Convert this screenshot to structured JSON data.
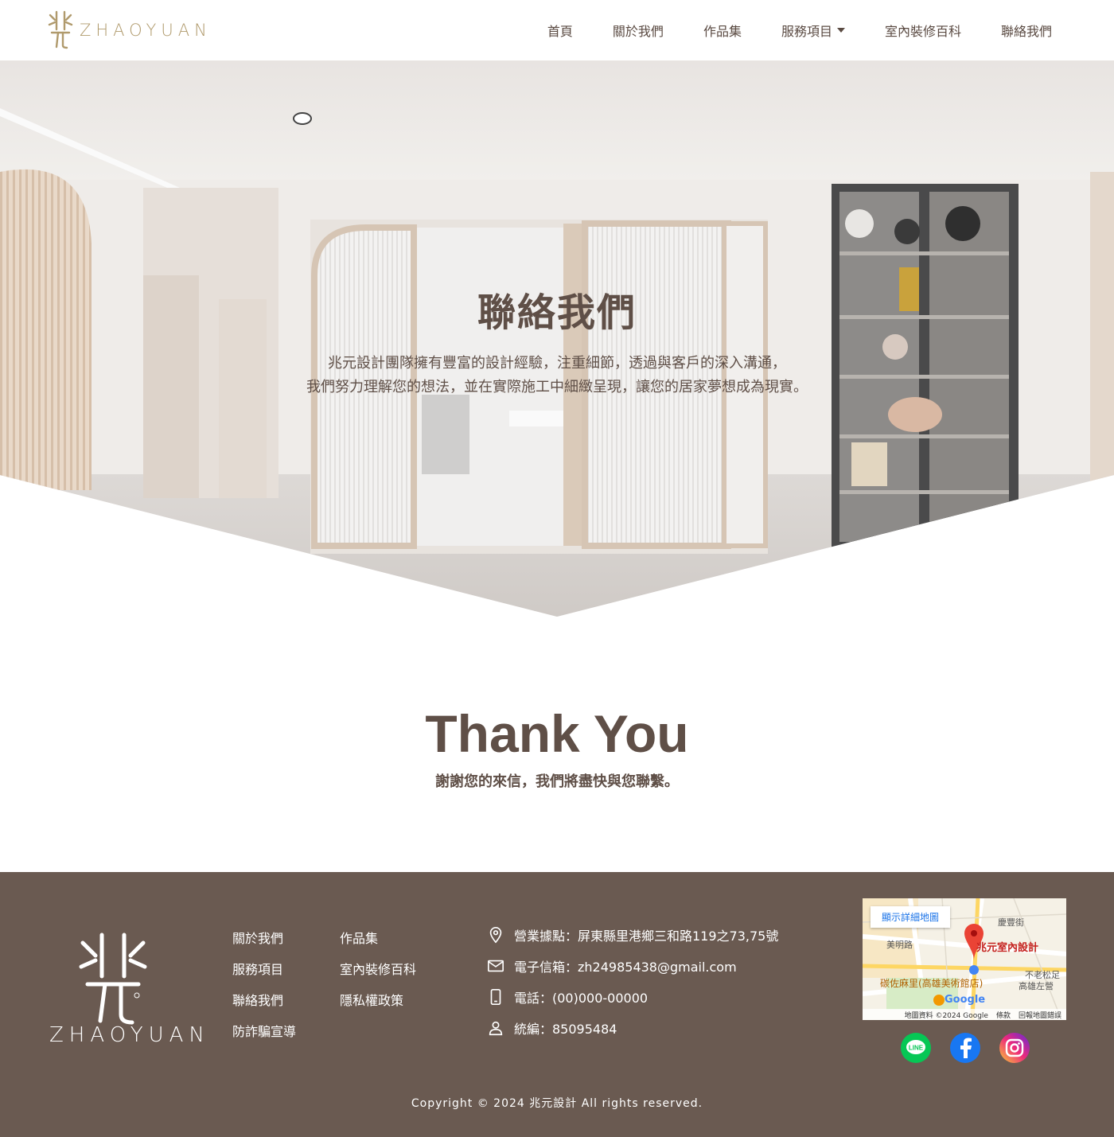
{
  "brand": {
    "logo_text": "ZHAOYUAN"
  },
  "nav": {
    "items": [
      {
        "label": "首頁"
      },
      {
        "label": "關於我們"
      },
      {
        "label": "作品集"
      },
      {
        "label": "服務項目"
      },
      {
        "label": "室內裝修百科"
      },
      {
        "label": "聯絡我們"
      }
    ]
  },
  "hero": {
    "title": "聯絡我們",
    "desc_line1": "兆元設計團隊擁有豐富的設計經驗，注重細節，透過與客戶的深入溝通，",
    "desc_line2": "我們努力理解您的想法，並在實際施工中細緻呈現，讓您的居家夢想成為現實。"
  },
  "thanks": {
    "title": "Thank You",
    "subtitle": "謝謝您的來信，我們將盡快與您聯繫。"
  },
  "footer": {
    "logo_text": "ZHAOYUAN",
    "links_col1": [
      "關於我們",
      "服務項目",
      "聯絡我們",
      "防詐騙宣導"
    ],
    "links_col2": [
      "作品集",
      "室內裝修百科",
      "隱私權政策"
    ],
    "info": {
      "address": "營業據點：屏東縣里港鄉三和路119之73,75號",
      "email": "電子信箱：zh24985438@gmail.com",
      "phone": "電話：(00)000-00000",
      "tax_id": "統編：85095484"
    },
    "map": {
      "button": "顯示詳細地圖",
      "pin_label": "兆元室內設計",
      "shop": "碳佐麻里(高雄美術館店)",
      "street1": "慶豐街",
      "street2": "不老松足",
      "street3": "高雄左營",
      "street4": "美明路",
      "logo": "Google",
      "foot_data": "地圖資料 ©2024 Google",
      "foot_terms": "條款",
      "foot_report": "回報地圖錯誤"
    },
    "socials": [
      "line-icon",
      "facebook-icon",
      "instagram-icon"
    ],
    "copyright": "Copyright © 2024 兆元設計 All rights reserved."
  },
  "colors": {
    "brand_brown": "#6a5a51",
    "text_brown": "#5f4f47",
    "gold": "#b09a6c"
  }
}
